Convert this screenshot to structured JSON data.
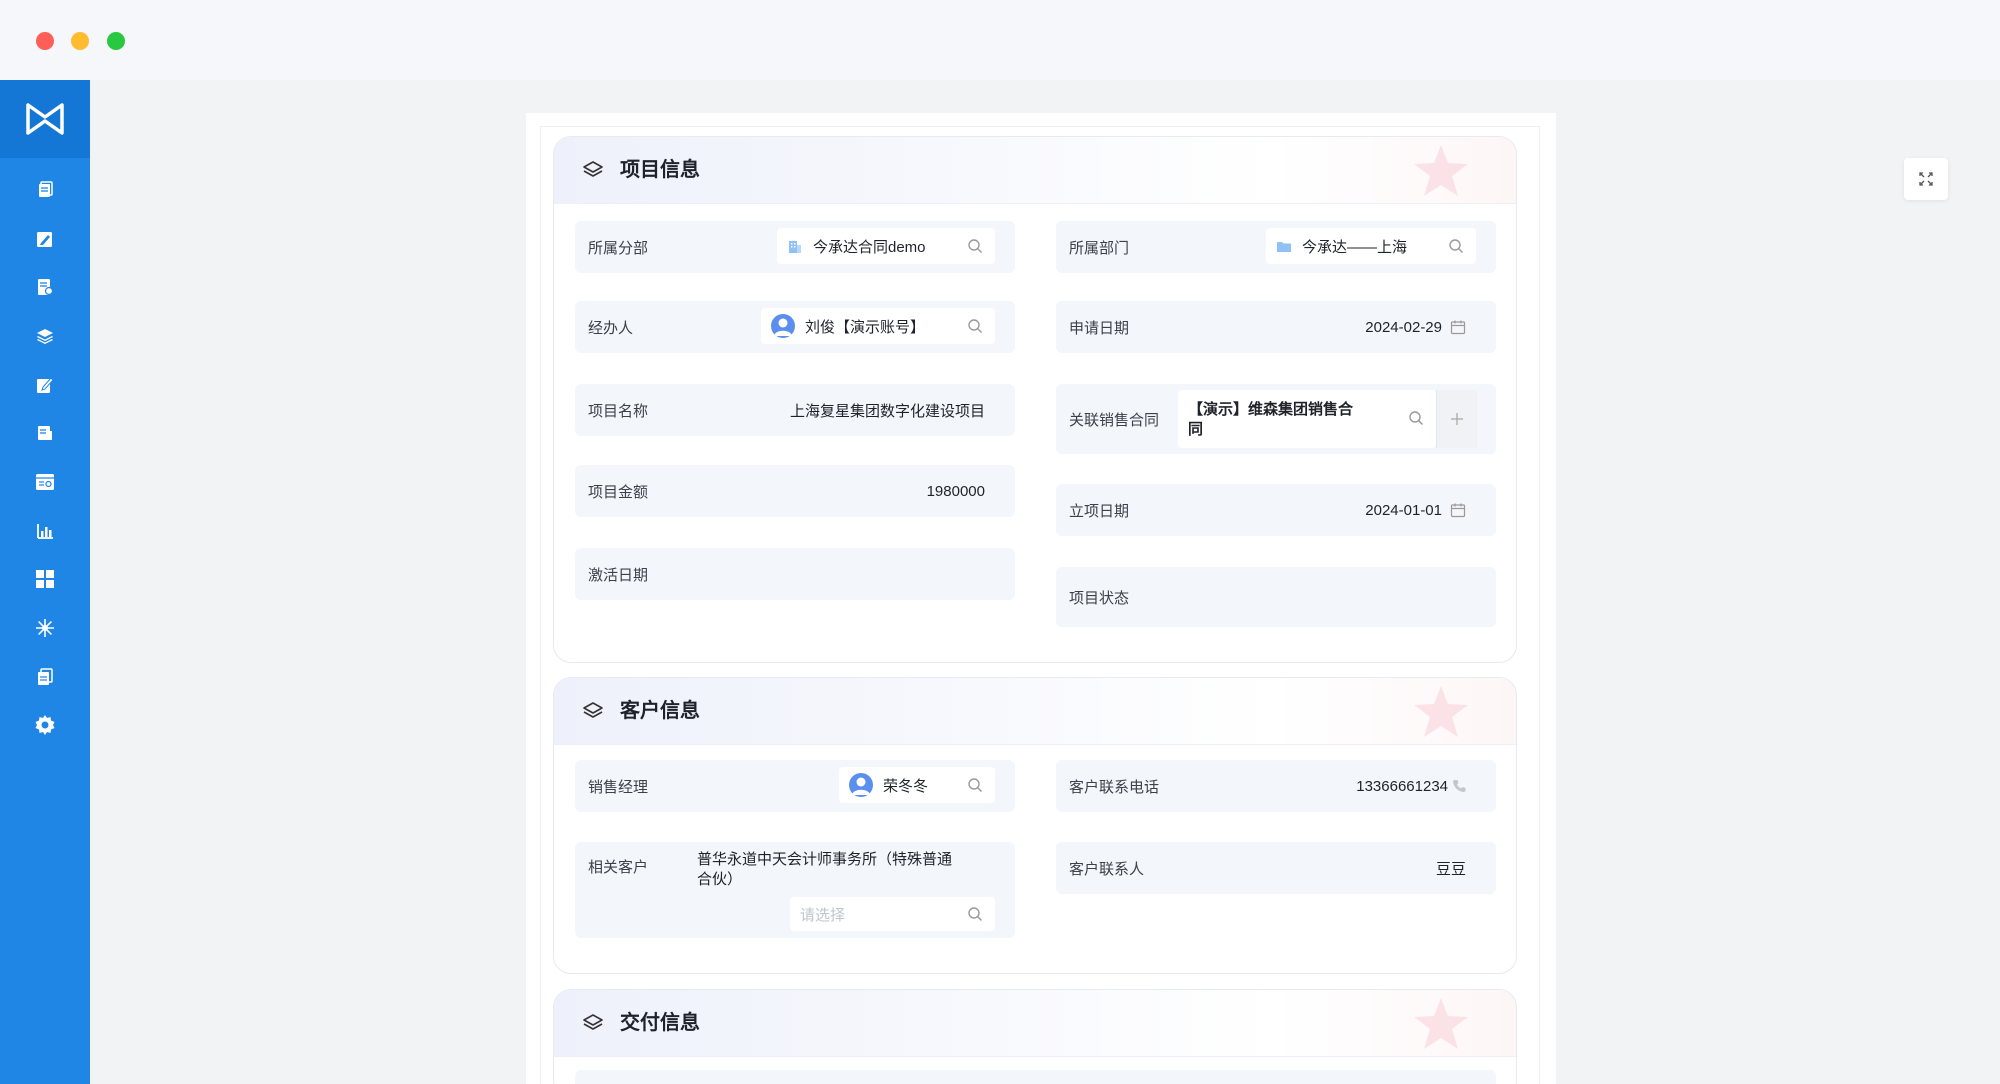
{
  "project_card": {
    "title": "项目信息",
    "branch_label": "所属分部",
    "branch_value": "今承达合同demo",
    "department_label": "所属部门",
    "department_value": "今承达——上海",
    "handler_label": "经办人",
    "handler_value": "刘俊【演示账号】",
    "apply_date_label": "申请日期",
    "apply_date_value": "2024-02-29",
    "project_name_label": "项目名称",
    "project_name_value": "上海复星集团数字化建设项目",
    "sales_contract_label": "关联销售合同",
    "sales_contract_value_line1": "【演示】维森集团销售合",
    "sales_contract_value_line2": "同",
    "amount_label": "项目金额",
    "amount_value": "1980000",
    "start_date_label": "立项日期",
    "start_date_value": "2024-01-01",
    "activate_date_label": "激活日期",
    "status_label": "项目状态"
  },
  "customer_card": {
    "title": "客户信息",
    "sales_manager_label": "销售经理",
    "sales_manager_value": "荣冬冬",
    "phone_label": "客户联系电话",
    "phone_value": "13366661234",
    "related_customer_label": "相关客户",
    "related_customer_line1": "普华永道中天会计师事务所（特殊普通",
    "related_customer_line2": "合伙）",
    "related_customer_placeholder": "请选择",
    "contact_label": "客户联系人",
    "contact_value": "豆豆"
  },
  "delivery_card": {
    "title": "交付信息"
  },
  "colors": {
    "sidebar": "#1f86e6",
    "sidebar_logo_bg": "#1477d6",
    "field_bg": "#f3f6fb",
    "accent_avatar": "#5a8ff0"
  },
  "icons": {
    "sidebar": [
      "document-icon",
      "edit-icon",
      "report-icon",
      "layers-icon",
      "write-icon",
      "file-icon",
      "search-list-icon",
      "bar-chart-icon",
      "grid-icon",
      "snowflake-icon",
      "copy-icon",
      "gear-icon"
    ]
  }
}
